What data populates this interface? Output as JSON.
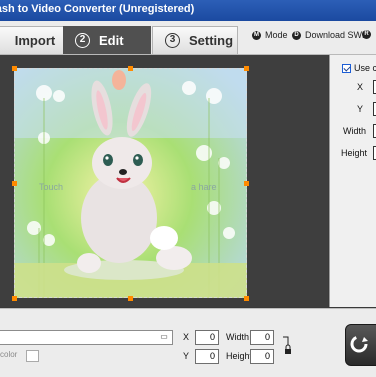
{
  "window": {
    "title": "Flash to Video Converter (Unregistered)"
  },
  "tabs": [
    {
      "number": "",
      "label": "Import"
    },
    {
      "number": "2",
      "label": "Edit"
    },
    {
      "number": "3",
      "label": "Setting"
    }
  ],
  "top_links": [
    {
      "icon": "mode-icon",
      "label": "Mode"
    },
    {
      "icon": "download-icon",
      "label": "Download SWF"
    }
  ],
  "canvas_text": {
    "left": "Touch",
    "right": "a hare"
  },
  "right_panel": {
    "use_crop_label": "Use cro",
    "use_crop_checked": true,
    "x_label": "X",
    "y_label": "Y",
    "width_label": "Width",
    "height_label": "Height"
  },
  "bottom": {
    "path_value": "",
    "bgcolor_label": "color",
    "x_label": "X",
    "x_value": "0",
    "y_label": "Y",
    "y_value": "0",
    "width_label": "Width",
    "width_value": "0",
    "height_label": "Height",
    "height_value": "0"
  },
  "colors": {
    "accent_orange": "#ff8b00",
    "title_blue": "#1b4aa0",
    "edit_tab": "#505050"
  }
}
